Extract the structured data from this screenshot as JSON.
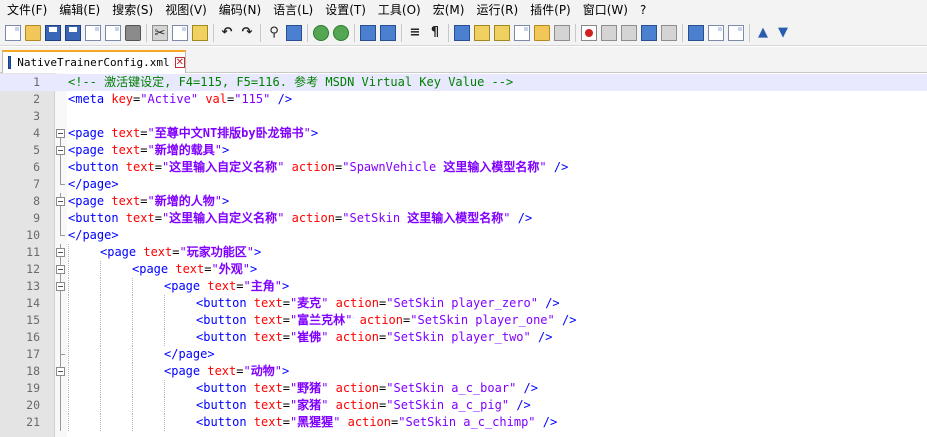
{
  "menu": [
    "文件(F)",
    "编辑(E)",
    "搜索(S)",
    "视图(V)",
    "编码(N)",
    "语言(L)",
    "设置(T)",
    "工具(O)",
    "宏(M)",
    "运行(R)",
    "插件(P)",
    "窗口(W)",
    "?"
  ],
  "toolbar_icons": [
    "new-file-icon",
    "open-file-icon",
    "save-icon",
    "save-all-icon",
    "close-icon",
    "close-all-icon",
    "print-icon",
    "cut-icon",
    "copy-icon",
    "paste-icon",
    "undo-icon",
    "redo-icon",
    "find-icon",
    "replace-icon",
    "zoom-in-icon",
    "zoom-out-icon",
    "sync-vertical-icon",
    "sync-horizontal-icon",
    "word-wrap-icon",
    "show-all-chars-icon",
    "indent-guide-icon",
    "lang-udl-icon",
    "doc-map-icon",
    "function-list-icon",
    "folder-workspace-icon",
    "monitor-icon",
    "record-macro-icon",
    "stop-record-icon",
    "play-macro-icon",
    "run-macro-multiple-icon",
    "save-macro-icon",
    "spellcheck-icon",
    "compare-icon",
    "bookmark-icon",
    "move-up-icon",
    "move-down-icon"
  ],
  "tab": {
    "label": "NativeTrainerConfig.xml",
    "close": "✕"
  },
  "lines": [
    {
      "n": "1",
      "fold": "none",
      "indent": 0,
      "current": true,
      "parts": [
        [
          "comment",
          "<!-- 激活键设定, F4=115, F5=116. 参考 MSDN Virtual Key Value -->"
        ]
      ]
    },
    {
      "n": "2",
      "fold": "none",
      "indent": 0,
      "parts": [
        [
          "tag",
          "<meta "
        ],
        [
          "attr",
          "key"
        ],
        [
          "plain",
          "="
        ],
        [
          "str",
          "\"Active\""
        ],
        [
          "plain",
          " "
        ],
        [
          "attr",
          "val"
        ],
        [
          "plain",
          "="
        ],
        [
          "str",
          "\"115\""
        ],
        [
          "plain",
          " "
        ],
        [
          "tag",
          "/>"
        ]
      ]
    },
    {
      "n": "3",
      "fold": "none",
      "indent": 0,
      "parts": []
    },
    {
      "n": "4",
      "fold": "open",
      "indent": 0,
      "parts": [
        [
          "tag",
          "<page "
        ],
        [
          "attr",
          "text"
        ],
        [
          "plain",
          "="
        ],
        [
          "str",
          "\""
        ],
        [
          "cjk",
          "至尊中文NT排版by卧龙锦书"
        ],
        [
          "str",
          "\""
        ],
        [
          "tag",
          ">"
        ]
      ]
    },
    {
      "n": "5",
      "fold": "open",
      "indent": 0,
      "parts": [
        [
          "tag",
          "<page "
        ],
        [
          "attr",
          "text"
        ],
        [
          "plain",
          "="
        ],
        [
          "str",
          "\""
        ],
        [
          "cjk",
          "新增的载具"
        ],
        [
          "str",
          "\""
        ],
        [
          "tag",
          ">"
        ]
      ]
    },
    {
      "n": "6",
      "fold": "line",
      "indent": 0,
      "parts": [
        [
          "tag",
          "<button "
        ],
        [
          "attr",
          "text"
        ],
        [
          "plain",
          "="
        ],
        [
          "str",
          "\""
        ],
        [
          "cjk",
          "这里输入自定义名称"
        ],
        [
          "str",
          "\""
        ],
        [
          "plain",
          " "
        ],
        [
          "attr",
          "action"
        ],
        [
          "plain",
          "="
        ],
        [
          "str",
          "\"SpawnVehicle "
        ],
        [
          "cjk",
          "这里输入模型名称"
        ],
        [
          "str",
          "\""
        ],
        [
          "plain",
          " "
        ],
        [
          "tag",
          "/>"
        ]
      ]
    },
    {
      "n": "7",
      "fold": "end",
      "indent": 0,
      "parts": [
        [
          "tag",
          "</page>"
        ]
      ]
    },
    {
      "n": "8",
      "fold": "open",
      "indent": 0,
      "parts": [
        [
          "tag",
          "<page "
        ],
        [
          "attr",
          "text"
        ],
        [
          "plain",
          "="
        ],
        [
          "str",
          "\""
        ],
        [
          "cjk",
          "新增的人物"
        ],
        [
          "str",
          "\""
        ],
        [
          "tag",
          ">"
        ]
      ]
    },
    {
      "n": "9",
      "fold": "line",
      "indent": 0,
      "parts": [
        [
          "tag",
          "<button "
        ],
        [
          "attr",
          "text"
        ],
        [
          "plain",
          "="
        ],
        [
          "str",
          "\""
        ],
        [
          "cjk",
          "这里输入自定义名称"
        ],
        [
          "str",
          "\""
        ],
        [
          "plain",
          " "
        ],
        [
          "attr",
          "action"
        ],
        [
          "plain",
          "="
        ],
        [
          "str",
          "\"SetSkin "
        ],
        [
          "cjk",
          "这里输入模型名称"
        ],
        [
          "str",
          "\""
        ],
        [
          "plain",
          " "
        ],
        [
          "tag",
          "/>"
        ]
      ]
    },
    {
      "n": "10",
      "fold": "end",
      "indent": 0,
      "parts": [
        [
          "tag",
          "</page>"
        ]
      ]
    },
    {
      "n": "11",
      "fold": "open",
      "indent": 1,
      "parts": [
        [
          "tag",
          "<page "
        ],
        [
          "attr",
          "text"
        ],
        [
          "plain",
          "="
        ],
        [
          "str",
          "\""
        ],
        [
          "cjk",
          "玩家功能区"
        ],
        [
          "str",
          "\""
        ],
        [
          "tag",
          ">"
        ]
      ]
    },
    {
      "n": "12",
      "fold": "open",
      "indent": 2,
      "parts": [
        [
          "tag",
          "<page "
        ],
        [
          "attr",
          "text"
        ],
        [
          "plain",
          "="
        ],
        [
          "str",
          "\""
        ],
        [
          "cjk",
          "外观"
        ],
        [
          "str",
          "\""
        ],
        [
          "tag",
          ">"
        ]
      ]
    },
    {
      "n": "13",
      "fold": "open",
      "indent": 3,
      "parts": [
        [
          "tag",
          "<page "
        ],
        [
          "attr",
          "text"
        ],
        [
          "plain",
          "="
        ],
        [
          "str",
          "\""
        ],
        [
          "cjk",
          "主角"
        ],
        [
          "str",
          "\""
        ],
        [
          "tag",
          ">"
        ]
      ]
    },
    {
      "n": "14",
      "fold": "line",
      "indent": 4,
      "parts": [
        [
          "tag",
          "<button "
        ],
        [
          "attr",
          "text"
        ],
        [
          "plain",
          "="
        ],
        [
          "str",
          "\""
        ],
        [
          "cjk",
          "麦克"
        ],
        [
          "str",
          "\""
        ],
        [
          "plain",
          " "
        ],
        [
          "attr",
          "action"
        ],
        [
          "plain",
          "="
        ],
        [
          "str",
          "\"SetSkin player_zero\""
        ],
        [
          "plain",
          " "
        ],
        [
          "tag",
          "/>"
        ]
      ]
    },
    {
      "n": "15",
      "fold": "line",
      "indent": 4,
      "parts": [
        [
          "tag",
          "<button "
        ],
        [
          "attr",
          "text"
        ],
        [
          "plain",
          "="
        ],
        [
          "str",
          "\""
        ],
        [
          "cjk",
          "富兰克林"
        ],
        [
          "str",
          "\""
        ],
        [
          "plain",
          " "
        ],
        [
          "attr",
          "action"
        ],
        [
          "plain",
          "="
        ],
        [
          "str",
          "\"SetSkin player_one\""
        ],
        [
          "plain",
          " "
        ],
        [
          "tag",
          "/>"
        ]
      ]
    },
    {
      "n": "16",
      "fold": "line",
      "indent": 4,
      "parts": [
        [
          "tag",
          "<button "
        ],
        [
          "attr",
          "text"
        ],
        [
          "plain",
          "="
        ],
        [
          "str",
          "\""
        ],
        [
          "cjk",
          "崔佛"
        ],
        [
          "str",
          "\""
        ],
        [
          "plain",
          " "
        ],
        [
          "attr",
          "action"
        ],
        [
          "plain",
          "="
        ],
        [
          "str",
          "\"SetSkin player_two\""
        ],
        [
          "plain",
          " "
        ],
        [
          "tag",
          "/>"
        ]
      ]
    },
    {
      "n": "17",
      "fold": "end",
      "indent": 3,
      "parts": [
        [
          "tag",
          "</page>"
        ]
      ]
    },
    {
      "n": "18",
      "fold": "open",
      "indent": 3,
      "parts": [
        [
          "tag",
          "<page "
        ],
        [
          "attr",
          "text"
        ],
        [
          "plain",
          "="
        ],
        [
          "str",
          "\""
        ],
        [
          "cjk",
          "动物"
        ],
        [
          "str",
          "\""
        ],
        [
          "tag",
          ">"
        ]
      ]
    },
    {
      "n": "19",
      "fold": "line",
      "indent": 4,
      "parts": [
        [
          "tag",
          "<button "
        ],
        [
          "attr",
          "text"
        ],
        [
          "plain",
          "="
        ],
        [
          "str",
          "\""
        ],
        [
          "cjk",
          "野猪"
        ],
        [
          "str",
          "\""
        ],
        [
          "plain",
          " "
        ],
        [
          "attr",
          "action"
        ],
        [
          "plain",
          "="
        ],
        [
          "str",
          "\"SetSkin a_c_boar\""
        ],
        [
          "plain",
          " "
        ],
        [
          "tag",
          "/>"
        ]
      ]
    },
    {
      "n": "20",
      "fold": "line",
      "indent": 4,
      "parts": [
        [
          "tag",
          "<button "
        ],
        [
          "attr",
          "text"
        ],
        [
          "plain",
          "="
        ],
        [
          "str",
          "\""
        ],
        [
          "cjk",
          "家猪"
        ],
        [
          "str",
          "\""
        ],
        [
          "plain",
          " "
        ],
        [
          "attr",
          "action"
        ],
        [
          "plain",
          "="
        ],
        [
          "str",
          "\"SetSkin a_c_pig\""
        ],
        [
          "plain",
          " "
        ],
        [
          "tag",
          "/>"
        ]
      ]
    },
    {
      "n": "21",
      "fold": "line",
      "indent": 4,
      "parts": [
        [
          "tag",
          "<button "
        ],
        [
          "attr",
          "text"
        ],
        [
          "plain",
          "="
        ],
        [
          "str",
          "\""
        ],
        [
          "cjk",
          "黑猩猩"
        ],
        [
          "str",
          "\""
        ],
        [
          "plain",
          " "
        ],
        [
          "attr",
          "action"
        ],
        [
          "plain",
          "="
        ],
        [
          "str",
          "\"SetSkin a_c_chimp\""
        ],
        [
          "plain",
          " "
        ],
        [
          "tag",
          "/>"
        ]
      ]
    }
  ]
}
